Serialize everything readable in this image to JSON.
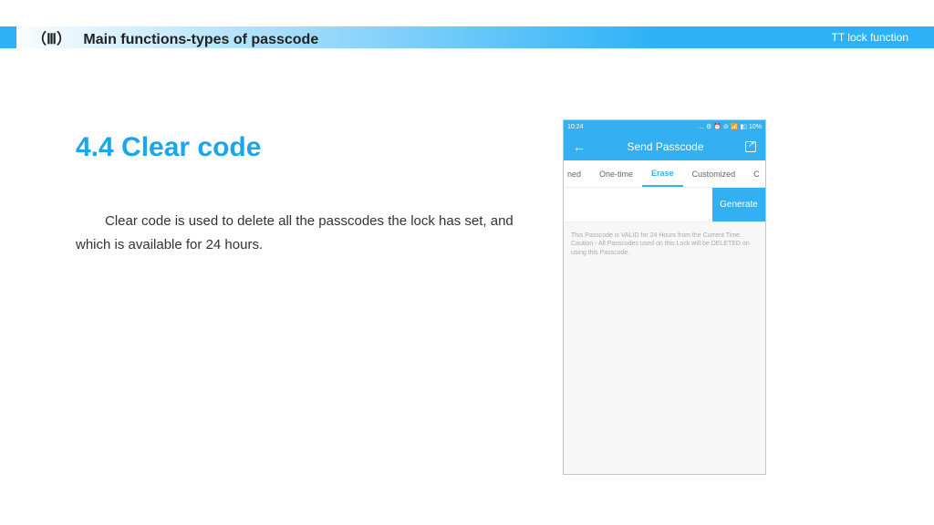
{
  "header": {
    "section_marker": "（Ⅲ）",
    "title": "Main functions-types of passcode",
    "right_label": "TT lock function"
  },
  "section": {
    "heading": "4.4 Clear code",
    "body": "Clear code is used to delete all the passcodes the lock has set, and which is available for 24 hours."
  },
  "phone": {
    "status_time": "10:24",
    "status_icons": "… ⚙ ⏰ ⊘ 📶 ▮▯ 10%",
    "app_title": "Send Passcode",
    "tabs": {
      "t0": "ned",
      "t1": "One-time",
      "t2": "Erase",
      "t3": "Customized",
      "t4": "C"
    },
    "generate": "Generate",
    "note": "This Passcode is VALID for 24 Hours from the Current Time. Caution - All Passcodes used on this Lock will be DELETED on using this Passcode."
  }
}
